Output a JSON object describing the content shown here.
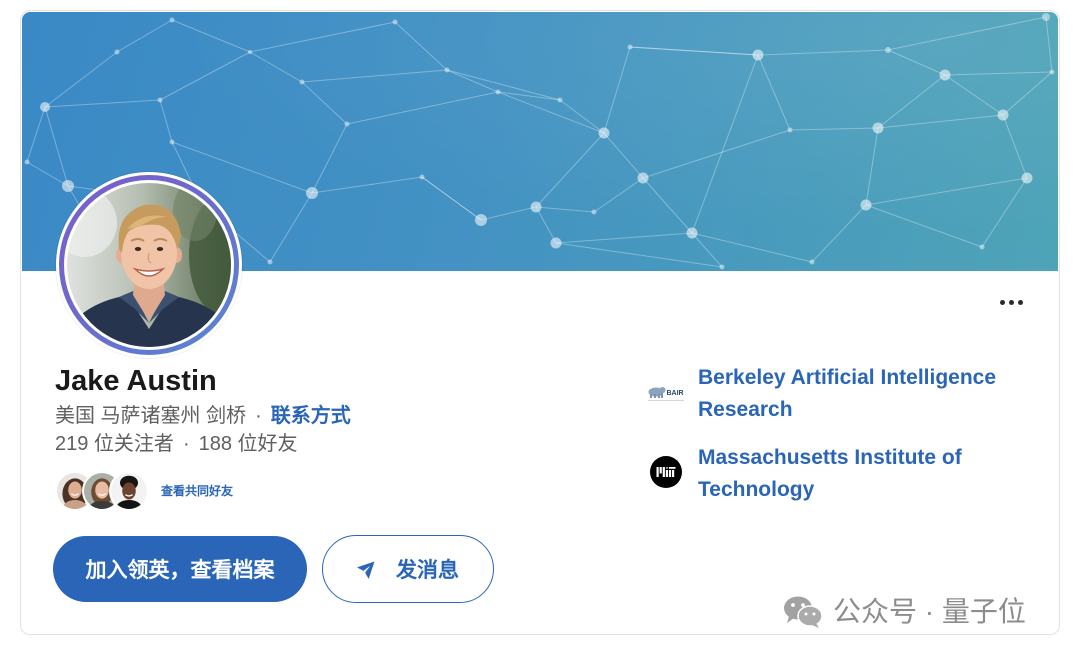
{
  "profile": {
    "name": "Jake Austin",
    "location": "美国 马萨诸塞州 剑桥",
    "separator": "·",
    "contact_link": "联系方式",
    "followers": "219 位关注者",
    "connections": "188 位好友",
    "mutual_link": "查看共同好友"
  },
  "actions": {
    "primary_label": "加入领英，查看档案",
    "message_label": "发消息",
    "message_icon": "send-icon",
    "more_icon": "more-horizontal-icon"
  },
  "organizations": [
    {
      "name": "Berkeley Artificial Intelligence Research",
      "logo": "bair-logo",
      "logo_text": "BAIR"
    },
    {
      "name": "Massachusetts Institute of Technology",
      "logo": "mit-logo",
      "logo_text": "MIT"
    }
  ],
  "watermark": {
    "icon": "wechat-icon",
    "text": "公众号 · 量子位"
  },
  "colors": {
    "banner_start": "#3a89c6",
    "banner_end": "#4ea4b7",
    "accent": "#2a65b8",
    "text_primary": "#1a1a1a",
    "text_muted": "#5f5f5f",
    "avatar_ring_start": "#7b5dcb",
    "avatar_ring_end": "#5788d3",
    "watermark": "#8c8c8c"
  }
}
